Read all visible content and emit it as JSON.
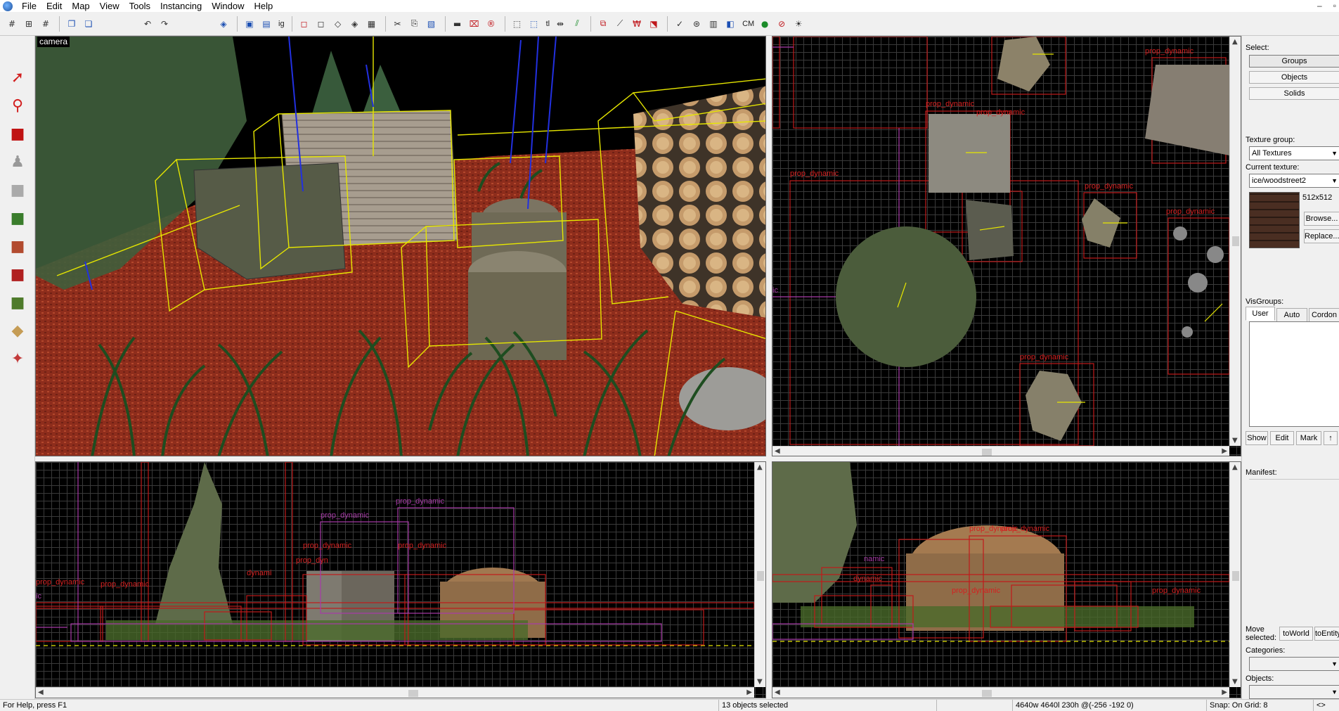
{
  "menubar": {
    "items": [
      "File",
      "Edit",
      "Map",
      "View",
      "Tools",
      "Instancing",
      "Window",
      "Help"
    ],
    "window_controls": [
      "–",
      "▫"
    ]
  },
  "toolbar": {
    "text_items": [
      "ig",
      "tl",
      "CM"
    ]
  },
  "viewports": {
    "camera": {
      "label": "camera"
    },
    "top": {
      "entity_labels": [
        "prop_dynamic",
        "prop_dynamic",
        "prop_dynamic",
        "prop_dynamic",
        "prop_dynamic",
        "prop_dynamic",
        "prop_dynamic",
        "ic"
      ]
    },
    "front": {
      "entity_labels": [
        "prop_dynamic",
        "prop_dynamic",
        "prop_dynamic",
        "prop_dynamic",
        "prop_dyn",
        "prop_dynamic",
        "prop_dynamic",
        "dynami",
        "ic"
      ]
    },
    "side": {
      "entity_labels": [
        "prop_dynamic",
        "prop_dynamic",
        "prop_dynamic",
        "prop_dynamic",
        "dynamic",
        "namic"
      ]
    }
  },
  "rightpanel": {
    "select_label": "Select:",
    "select_buttons": [
      "Groups",
      "Objects",
      "Solids"
    ],
    "texture_group_label": "Texture group:",
    "texture_group_value": "All Textures",
    "current_texture_label": "Current texture:",
    "current_texture_value": "ice/woodstreet2",
    "texture_size": "512x512",
    "browse_label": "Browse...",
    "replace_label": "Replace...",
    "visgroups_label": "VisGroups:",
    "visgroup_tabs": [
      "User",
      "Auto",
      "Cordon"
    ],
    "visgroup_buttons": [
      "Show",
      "Edit",
      "Mark",
      "↑"
    ],
    "manifest_label": "Manifest:",
    "move_selected_label": "Move selected:",
    "to_world_label": "toWorld",
    "to_entity_label": "toEntity",
    "categories_label": "Categories:",
    "objects_label": "Objects:"
  },
  "statusbar": {
    "help": "For Help, press F1",
    "selection": "13 objects selected",
    "dimensions": "4640w 4640l 230h @(-256 -192 0)",
    "snap": "Snap: On Grid: 8",
    "extra": "<>"
  }
}
